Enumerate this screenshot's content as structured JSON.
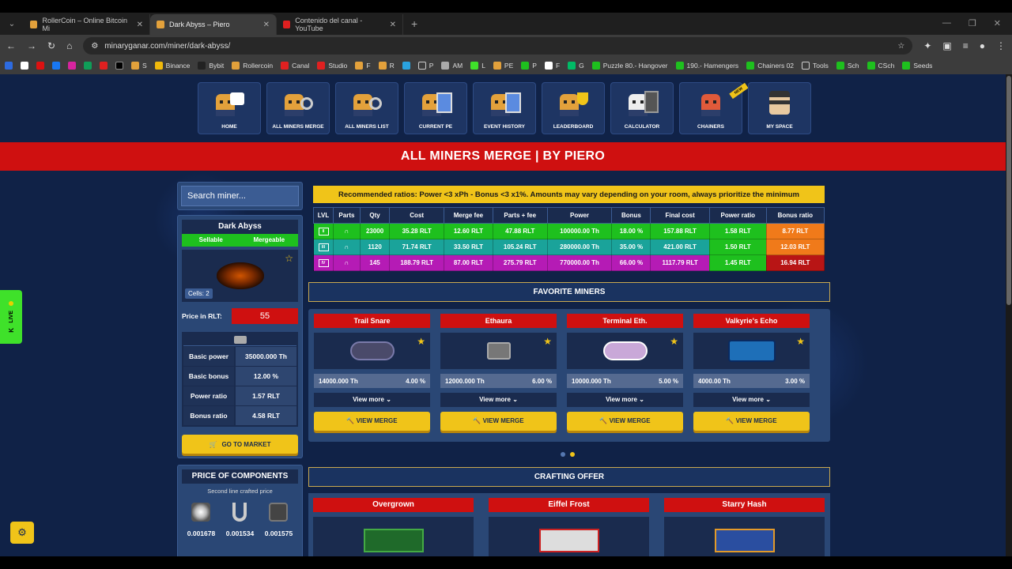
{
  "browser": {
    "tabs": [
      {
        "title": "RollerCoin – Online Bitcoin Mi",
        "color": "#e3a13b"
      },
      {
        "title": "Dark Abyss – Piero",
        "color": "#e3a13b"
      },
      {
        "title": "Contenido del canal - YouTube",
        "color": "#e02020"
      }
    ],
    "url": "minaryganar.com/miner/dark-abyss/",
    "bookmarks": [
      "S",
      "Binance",
      "Bybit",
      "Rollercoin",
      "Canal",
      "Studio",
      "F",
      "R",
      "P",
      "AM",
      "L",
      "PE",
      "P",
      "F",
      "G",
      "Puzzle 80.- Hangover",
      "190.- Hamengers",
      "Chainers 02",
      "Tools",
      "Sch",
      "CSch",
      "Seeds"
    ]
  },
  "nav": [
    {
      "label": "HOME",
      "icon": "home-icon"
    },
    {
      "label": "ALL MINERS MERGE",
      "icon": "wrench-icon"
    },
    {
      "label": "ALL MINERS LIST",
      "icon": "wrench-icon"
    },
    {
      "label": "CURRENT PE",
      "icon": "list-icon"
    },
    {
      "label": "EVENT HISTORY",
      "icon": "history-icon"
    },
    {
      "label": "LEADERBOARD",
      "icon": "trophy-icon"
    },
    {
      "label": "CALCULATOR",
      "icon": "calculator-icon"
    },
    {
      "label": "CHAINERS",
      "icon": "chainers-icon",
      "badge": "NEW"
    },
    {
      "label": "MY SPACE",
      "icon": "avatar-icon"
    }
  ],
  "banner": "ALL MINERS MERGE | BY PIERO",
  "search": {
    "placeholder": "Search miner..."
  },
  "miner": {
    "name": "Dark Abyss",
    "tags": [
      "Sellable",
      "Mergeable"
    ],
    "cells": "Cells: 2",
    "price_label": "Price in RLT:",
    "price": "55",
    "stats": [
      {
        "k": "Basic power",
        "v": "35000.000 Th"
      },
      {
        "k": "Basic bonus",
        "v": "12.00 %"
      },
      {
        "k": "Power ratio",
        "v": "1.57 RLT"
      },
      {
        "k": "Bonus ratio",
        "v": "4.58 RLT"
      }
    ],
    "market_btn": "GO TO MARKET"
  },
  "components": {
    "title": "PRICE OF COMPONENTS",
    "subtitle": "Second line crafted price",
    "items": [
      {
        "icon": "fan-icon",
        "value": "0.001678"
      },
      {
        "icon": "wire-icon",
        "value": "0.001534"
      },
      {
        "icon": "chip-icon",
        "value": "0.001575"
      }
    ]
  },
  "recommendation": "Recommended ratios: Power <3 xPh - Bonus <3 x1%. Amounts may vary depending on your room, always prioritize the minimum",
  "table": {
    "headers": [
      "LVL",
      "Parts",
      "Qty",
      "Cost",
      "Merge fee",
      "Parts + fee",
      "Power",
      "Bonus",
      "Final cost",
      "Power ratio",
      "Bonus ratio"
    ],
    "rows": [
      {
        "lvl": "II",
        "qty": "23000",
        "cost": "35.28 RLT",
        "fee": "12.60 RLT",
        "pf": "47.88 RLT",
        "power": "100000.00 Th",
        "bonus": "18.00 %",
        "final": "157.88 RLT",
        "pr": "1.58 RLT",
        "br": "8.77 RLT"
      },
      {
        "lvl": "III",
        "qty": "1120",
        "cost": "71.74 RLT",
        "fee": "33.50 RLT",
        "pf": "105.24 RLT",
        "power": "280000.00 Th",
        "bonus": "35.00 %",
        "final": "421.00 RLT",
        "pr": "1.50 RLT",
        "br": "12.03 RLT"
      },
      {
        "lvl": "IV",
        "qty": "145",
        "cost": "188.79 RLT",
        "fee": "87.00 RLT",
        "pf": "275.79 RLT",
        "power": "770000.00 Th",
        "bonus": "66.00 %",
        "final": "1117.79 RLT",
        "pr": "1.45 RLT",
        "br": "16.94 RLT"
      }
    ]
  },
  "favorites": {
    "title": "FAVORITE MINERS",
    "items": [
      {
        "name": "Trail Snare",
        "power": "14000.000 Th",
        "bonus": "4.00 %"
      },
      {
        "name": "Ethaura",
        "power": "12000.000 Th",
        "bonus": "6.00 %"
      },
      {
        "name": "Terminal Eth.",
        "power": "10000.000 Th",
        "bonus": "5.00 %"
      },
      {
        "name": "Valkyrie's Echo",
        "power": "4000.00 Th",
        "bonus": "3.00 %"
      }
    ],
    "view_more": "View more",
    "view_merge": "VIEW MERGE"
  },
  "crafting": {
    "title": "CRAFTING OFFER",
    "items": [
      "Overgrown",
      "Eiffel Frost",
      "Starry Hash"
    ]
  },
  "live": "LIVE"
}
